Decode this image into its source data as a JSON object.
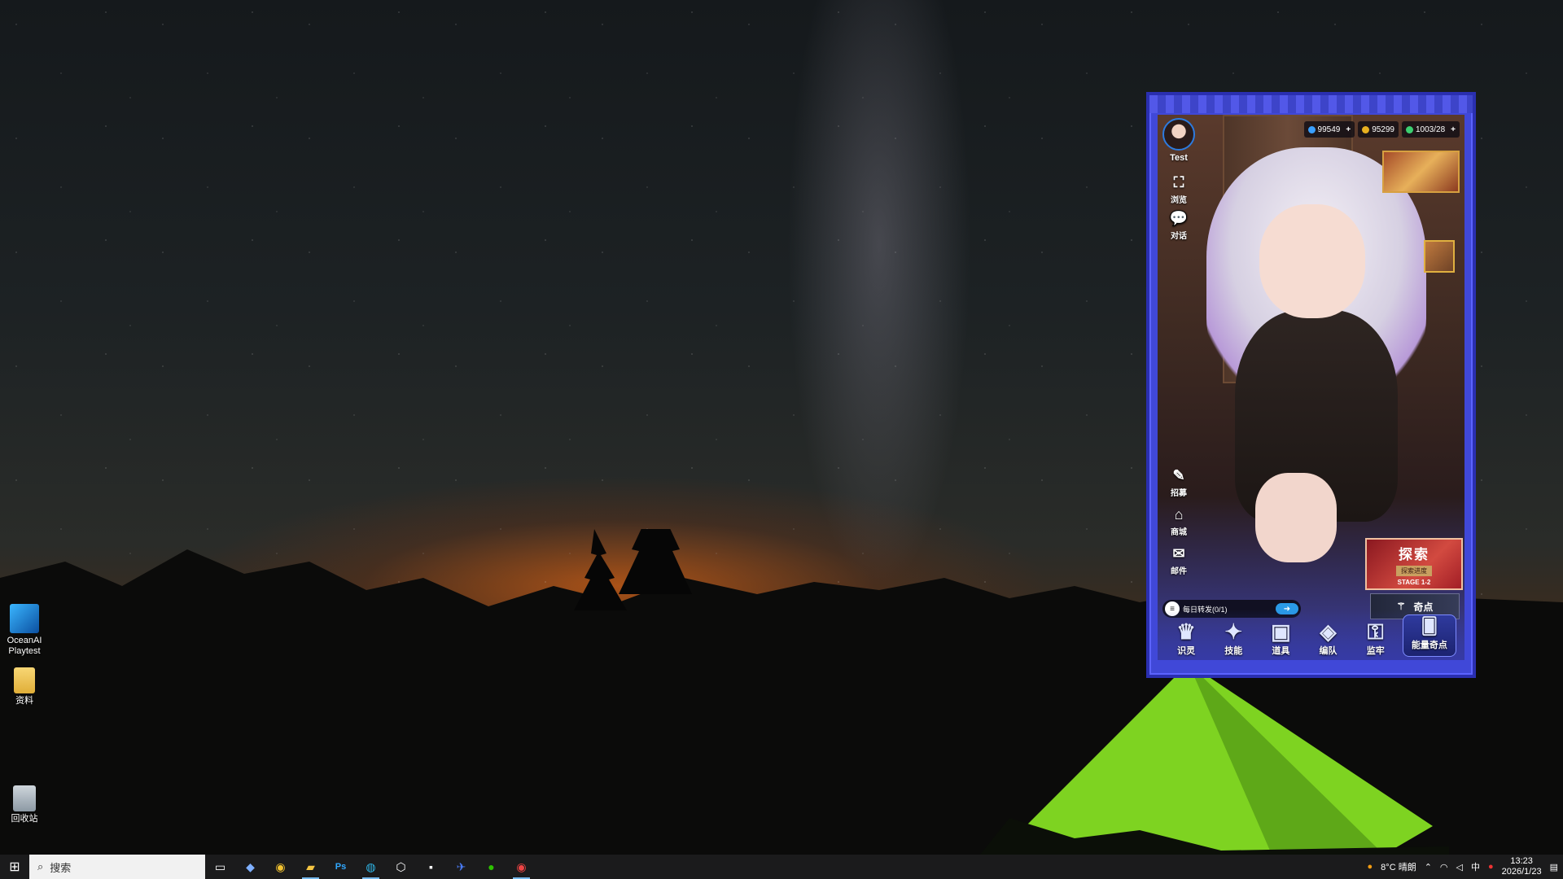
{
  "desktop": {
    "icons": [
      {
        "label": "OceanAI Playtest"
      },
      {
        "label": "资料"
      },
      {
        "label": "回收站"
      }
    ]
  },
  "game": {
    "player": {
      "name": "Test"
    },
    "resources": [
      {
        "icon": "gem-icon",
        "color": "#3aa0ff",
        "value": "99549"
      },
      {
        "icon": "coin-icon",
        "color": "#e8b020",
        "value": "95299"
      },
      {
        "icon": "energy-icon",
        "color": "#3ccf70",
        "value": "1003/28"
      }
    ],
    "side_top": [
      {
        "label": "浏览",
        "icon": "frame-icon"
      },
      {
        "label": "对话",
        "icon": "chat-icon"
      }
    ],
    "side_bottom": [
      {
        "label": "招募",
        "icon": "recruit-icon"
      },
      {
        "label": "商城",
        "icon": "shop-icon"
      },
      {
        "label": "邮件",
        "icon": "mail-icon"
      }
    ],
    "explore": {
      "title": "探索",
      "progress_label": "探索进度",
      "stage": "STAGE 1-2"
    },
    "odd_point": {
      "label": "奇点"
    },
    "daily": {
      "label": "每日转发(0/1)"
    },
    "nav": [
      {
        "label": "识灵",
        "icon": "crown-icon"
      },
      {
        "label": "技能",
        "icon": "star-icon"
      },
      {
        "label": "道具",
        "icon": "chest-icon"
      },
      {
        "label": "编队",
        "icon": "formation-icon"
      },
      {
        "label": "监牢",
        "icon": "lock-icon"
      },
      {
        "label": "能量奇点",
        "icon": "cards-icon"
      }
    ]
  },
  "taskbar": {
    "search_placeholder": "搜索",
    "weather": "8°C 晴朗",
    "ime": "中",
    "time": "13:23",
    "date": "2026/1/23"
  }
}
